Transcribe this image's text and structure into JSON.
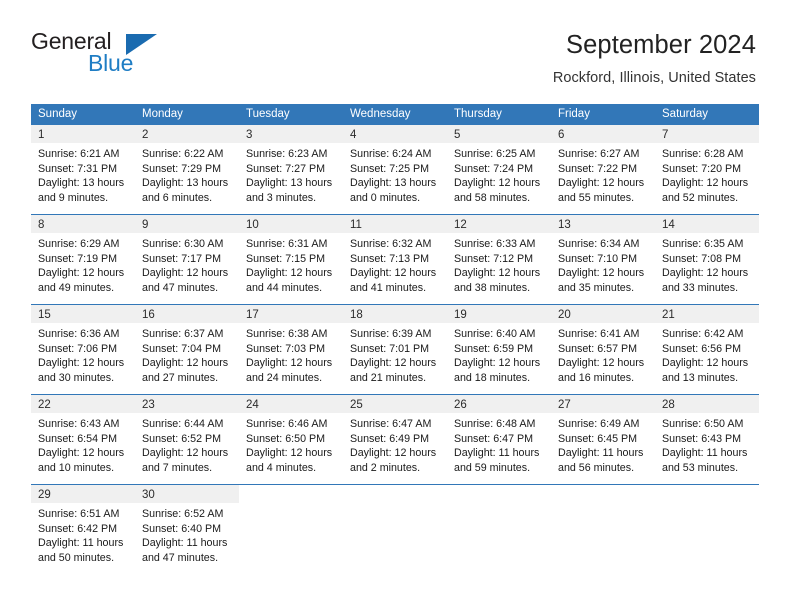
{
  "brand": {
    "name_part1": "General",
    "name_part2": "Blue",
    "triangle_icon": "triangle-icon"
  },
  "header": {
    "title": "September 2024",
    "location": "Rockford, Illinois, United States"
  },
  "colors": {
    "header_blue": "#3277b8",
    "daynum_band": "#f0f0f0",
    "brand_blue": "#1f7dc4",
    "brand_dark": "#231f20",
    "text": "#1a1a1a"
  },
  "calendar": {
    "day_headers": [
      "Sunday",
      "Monday",
      "Tuesday",
      "Wednesday",
      "Thursday",
      "Friday",
      "Saturday"
    ],
    "weeks": [
      [
        {
          "day": "1",
          "sunrise": "Sunrise: 6:21 AM",
          "sunset": "Sunset: 7:31 PM",
          "daylight1": "Daylight: 13 hours",
          "daylight2": "and 9 minutes."
        },
        {
          "day": "2",
          "sunrise": "Sunrise: 6:22 AM",
          "sunset": "Sunset: 7:29 PM",
          "daylight1": "Daylight: 13 hours",
          "daylight2": "and 6 minutes."
        },
        {
          "day": "3",
          "sunrise": "Sunrise: 6:23 AM",
          "sunset": "Sunset: 7:27 PM",
          "daylight1": "Daylight: 13 hours",
          "daylight2": "and 3 minutes."
        },
        {
          "day": "4",
          "sunrise": "Sunrise: 6:24 AM",
          "sunset": "Sunset: 7:25 PM",
          "daylight1": "Daylight: 13 hours",
          "daylight2": "and 0 minutes."
        },
        {
          "day": "5",
          "sunrise": "Sunrise: 6:25 AM",
          "sunset": "Sunset: 7:24 PM",
          "daylight1": "Daylight: 12 hours",
          "daylight2": "and 58 minutes."
        },
        {
          "day": "6",
          "sunrise": "Sunrise: 6:27 AM",
          "sunset": "Sunset: 7:22 PM",
          "daylight1": "Daylight: 12 hours",
          "daylight2": "and 55 minutes."
        },
        {
          "day": "7",
          "sunrise": "Sunrise: 6:28 AM",
          "sunset": "Sunset: 7:20 PM",
          "daylight1": "Daylight: 12 hours",
          "daylight2": "and 52 minutes."
        }
      ],
      [
        {
          "day": "8",
          "sunrise": "Sunrise: 6:29 AM",
          "sunset": "Sunset: 7:19 PM",
          "daylight1": "Daylight: 12 hours",
          "daylight2": "and 49 minutes."
        },
        {
          "day": "9",
          "sunrise": "Sunrise: 6:30 AM",
          "sunset": "Sunset: 7:17 PM",
          "daylight1": "Daylight: 12 hours",
          "daylight2": "and 47 minutes."
        },
        {
          "day": "10",
          "sunrise": "Sunrise: 6:31 AM",
          "sunset": "Sunset: 7:15 PM",
          "daylight1": "Daylight: 12 hours",
          "daylight2": "and 44 minutes."
        },
        {
          "day": "11",
          "sunrise": "Sunrise: 6:32 AM",
          "sunset": "Sunset: 7:13 PM",
          "daylight1": "Daylight: 12 hours",
          "daylight2": "and 41 minutes."
        },
        {
          "day": "12",
          "sunrise": "Sunrise: 6:33 AM",
          "sunset": "Sunset: 7:12 PM",
          "daylight1": "Daylight: 12 hours",
          "daylight2": "and 38 minutes."
        },
        {
          "day": "13",
          "sunrise": "Sunrise: 6:34 AM",
          "sunset": "Sunset: 7:10 PM",
          "daylight1": "Daylight: 12 hours",
          "daylight2": "and 35 minutes."
        },
        {
          "day": "14",
          "sunrise": "Sunrise: 6:35 AM",
          "sunset": "Sunset: 7:08 PM",
          "daylight1": "Daylight: 12 hours",
          "daylight2": "and 33 minutes."
        }
      ],
      [
        {
          "day": "15",
          "sunrise": "Sunrise: 6:36 AM",
          "sunset": "Sunset: 7:06 PM",
          "daylight1": "Daylight: 12 hours",
          "daylight2": "and 30 minutes."
        },
        {
          "day": "16",
          "sunrise": "Sunrise: 6:37 AM",
          "sunset": "Sunset: 7:04 PM",
          "daylight1": "Daylight: 12 hours",
          "daylight2": "and 27 minutes."
        },
        {
          "day": "17",
          "sunrise": "Sunrise: 6:38 AM",
          "sunset": "Sunset: 7:03 PM",
          "daylight1": "Daylight: 12 hours",
          "daylight2": "and 24 minutes."
        },
        {
          "day": "18",
          "sunrise": "Sunrise: 6:39 AM",
          "sunset": "Sunset: 7:01 PM",
          "daylight1": "Daylight: 12 hours",
          "daylight2": "and 21 minutes."
        },
        {
          "day": "19",
          "sunrise": "Sunrise: 6:40 AM",
          "sunset": "Sunset: 6:59 PM",
          "daylight1": "Daylight: 12 hours",
          "daylight2": "and 18 minutes."
        },
        {
          "day": "20",
          "sunrise": "Sunrise: 6:41 AM",
          "sunset": "Sunset: 6:57 PM",
          "daylight1": "Daylight: 12 hours",
          "daylight2": "and 16 minutes."
        },
        {
          "day": "21",
          "sunrise": "Sunrise: 6:42 AM",
          "sunset": "Sunset: 6:56 PM",
          "daylight1": "Daylight: 12 hours",
          "daylight2": "and 13 minutes."
        }
      ],
      [
        {
          "day": "22",
          "sunrise": "Sunrise: 6:43 AM",
          "sunset": "Sunset: 6:54 PM",
          "daylight1": "Daylight: 12 hours",
          "daylight2": "and 10 minutes."
        },
        {
          "day": "23",
          "sunrise": "Sunrise: 6:44 AM",
          "sunset": "Sunset: 6:52 PM",
          "daylight1": "Daylight: 12 hours",
          "daylight2": "and 7 minutes."
        },
        {
          "day": "24",
          "sunrise": "Sunrise: 6:46 AM",
          "sunset": "Sunset: 6:50 PM",
          "daylight1": "Daylight: 12 hours",
          "daylight2": "and 4 minutes."
        },
        {
          "day": "25",
          "sunrise": "Sunrise: 6:47 AM",
          "sunset": "Sunset: 6:49 PM",
          "daylight1": "Daylight: 12 hours",
          "daylight2": "and 2 minutes."
        },
        {
          "day": "26",
          "sunrise": "Sunrise: 6:48 AM",
          "sunset": "Sunset: 6:47 PM",
          "daylight1": "Daylight: 11 hours",
          "daylight2": "and 59 minutes."
        },
        {
          "day": "27",
          "sunrise": "Sunrise: 6:49 AM",
          "sunset": "Sunset: 6:45 PM",
          "daylight1": "Daylight: 11 hours",
          "daylight2": "and 56 minutes."
        },
        {
          "day": "28",
          "sunrise": "Sunrise: 6:50 AM",
          "sunset": "Sunset: 6:43 PM",
          "daylight1": "Daylight: 11 hours",
          "daylight2": "and 53 minutes."
        }
      ],
      [
        {
          "day": "29",
          "sunrise": "Sunrise: 6:51 AM",
          "sunset": "Sunset: 6:42 PM",
          "daylight1": "Daylight: 11 hours",
          "daylight2": "and 50 minutes."
        },
        {
          "day": "30",
          "sunrise": "Sunrise: 6:52 AM",
          "sunset": "Sunset: 6:40 PM",
          "daylight1": "Daylight: 11 hours",
          "daylight2": "and 47 minutes."
        },
        {
          "day": "",
          "sunrise": "",
          "sunset": "",
          "daylight1": "",
          "daylight2": ""
        },
        {
          "day": "",
          "sunrise": "",
          "sunset": "",
          "daylight1": "",
          "daylight2": ""
        },
        {
          "day": "",
          "sunrise": "",
          "sunset": "",
          "daylight1": "",
          "daylight2": ""
        },
        {
          "day": "",
          "sunrise": "",
          "sunset": "",
          "daylight1": "",
          "daylight2": ""
        },
        {
          "day": "",
          "sunrise": "",
          "sunset": "",
          "daylight1": "",
          "daylight2": ""
        }
      ]
    ]
  }
}
